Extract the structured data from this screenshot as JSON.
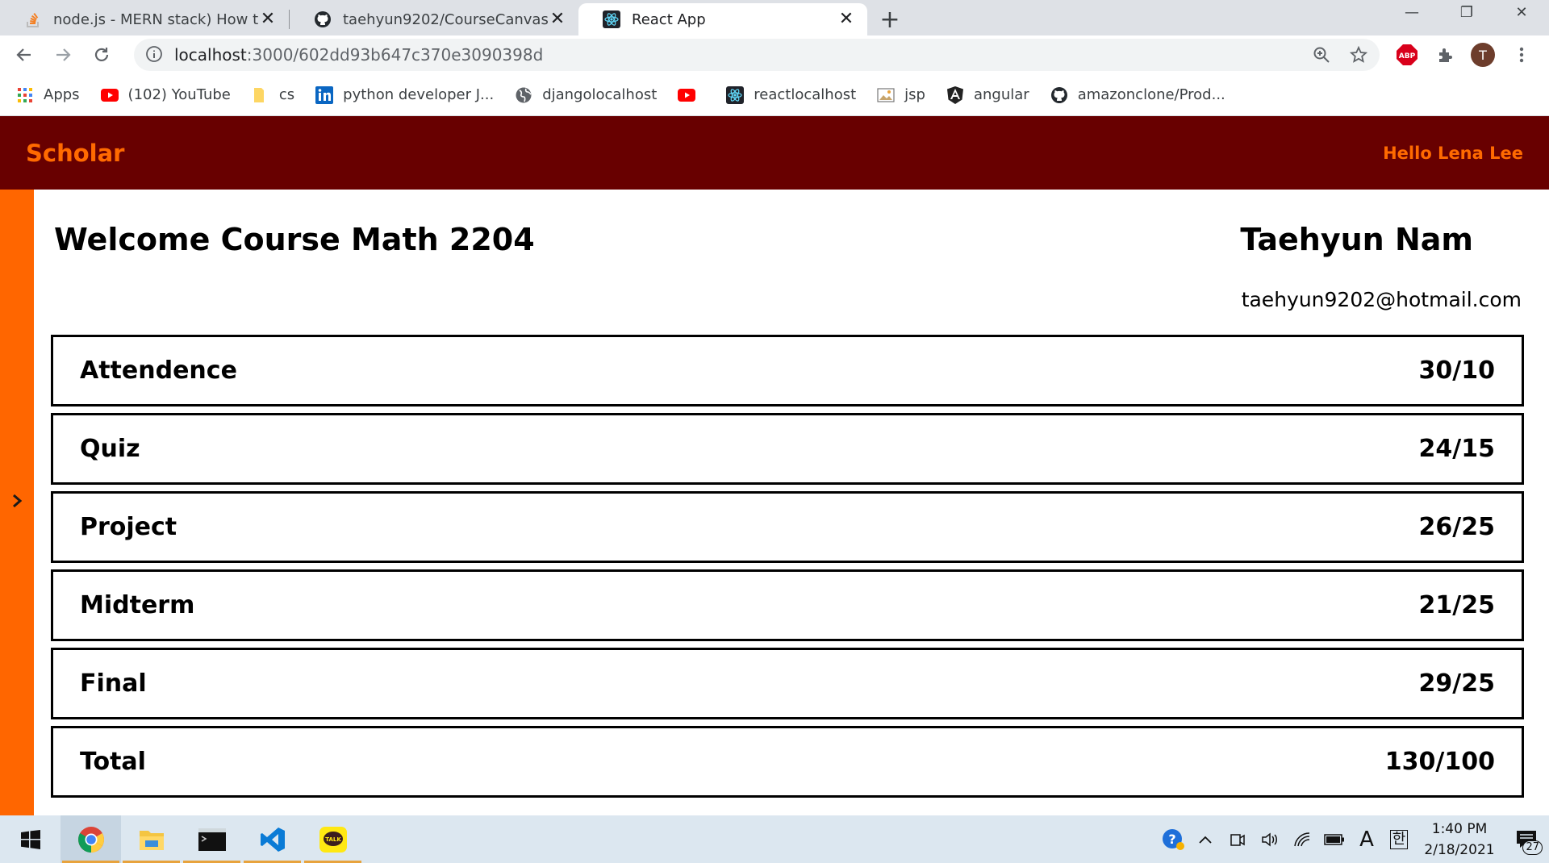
{
  "browser": {
    "tabs": [
      {
        "title": "node.js - MERN stack) How to ge",
        "icon": "stackoverflow-icon",
        "active": false
      },
      {
        "title": "taehyun9202/CourseCanvas",
        "icon": "github-icon",
        "active": false
      },
      {
        "title": "React App",
        "icon": "react-icon",
        "active": true
      }
    ],
    "url_host": "localhost",
    "url_path": ":3000/602dd93b647c370e3090398d",
    "profile_initial": "T",
    "adblock_label": "ABP",
    "bookmarks": [
      {
        "label": "Apps",
        "icon": "apps-grid-icon"
      },
      {
        "label": "(102) YouTube",
        "icon": "youtube-icon"
      },
      {
        "label": "cs",
        "icon": "folder-icon"
      },
      {
        "label": "python developer J...",
        "icon": "linkedin-icon"
      },
      {
        "label": "djangolocalhost",
        "icon": "globe-icon"
      },
      {
        "label": "",
        "icon": "youtube-icon"
      },
      {
        "label": "reactlocalhost",
        "icon": "react-icon"
      },
      {
        "label": "jsp",
        "icon": "image-icon"
      },
      {
        "label": "angular",
        "icon": "angular-icon"
      },
      {
        "label": "amazonclone/Prod...",
        "icon": "github-icon"
      }
    ]
  },
  "app": {
    "brand": "Scholar",
    "greeting": "Hello Lena Lee",
    "course_title": "Welcome Course Math 2204",
    "student_name": "Taehyun Nam",
    "student_email": "taehyun9202@hotmail.com",
    "grades": [
      {
        "label": "Attendence",
        "score": "30/10"
      },
      {
        "label": "Quiz",
        "score": "24/15"
      },
      {
        "label": "Project",
        "score": "26/25"
      },
      {
        "label": "Midterm",
        "score": "21/25"
      },
      {
        "label": "Final",
        "score": "29/25"
      },
      {
        "label": "Total",
        "score": "130/100"
      }
    ],
    "colors": {
      "appbar": "#680000",
      "accent": "#ff6600",
      "brand_text": "#ff6a00"
    }
  },
  "taskbar": {
    "time": "1:40 PM",
    "date": "2/18/2021",
    "notification_count": "27",
    "ime_label": "A",
    "lang_label": "한",
    "kakao_label": "TALK"
  }
}
